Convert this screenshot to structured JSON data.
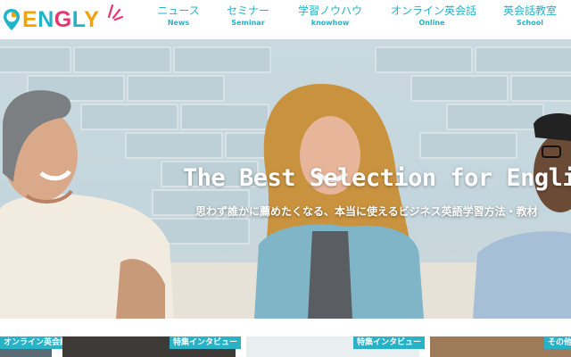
{
  "logo": {
    "text": "ENGLY"
  },
  "nav": [
    {
      "label": "ニュース",
      "sub": "News"
    },
    {
      "label": "セミナー",
      "sub": "Seminar"
    },
    {
      "label": "学習ノウハウ",
      "sub": "knowhow"
    },
    {
      "label": "オンライン英会話",
      "sub": "Online"
    },
    {
      "label": "英会話教室",
      "sub": "School"
    }
  ],
  "hero": {
    "title": "The Best Selection for English L",
    "subtitle": "思わず誰かに薦めたくなる、本当に使えるビジネス英語学習方法・教材"
  },
  "cards": [
    {
      "tag": "オンライン英会話"
    },
    {
      "tag": "特集インタビュー"
    },
    {
      "tag": "特集インタビュー"
    },
    {
      "tag": "その他"
    }
  ],
  "colors": {
    "accent": "#27b2c7",
    "logo_yellow": "#f4a300",
    "logo_pink": "#e8356d"
  }
}
